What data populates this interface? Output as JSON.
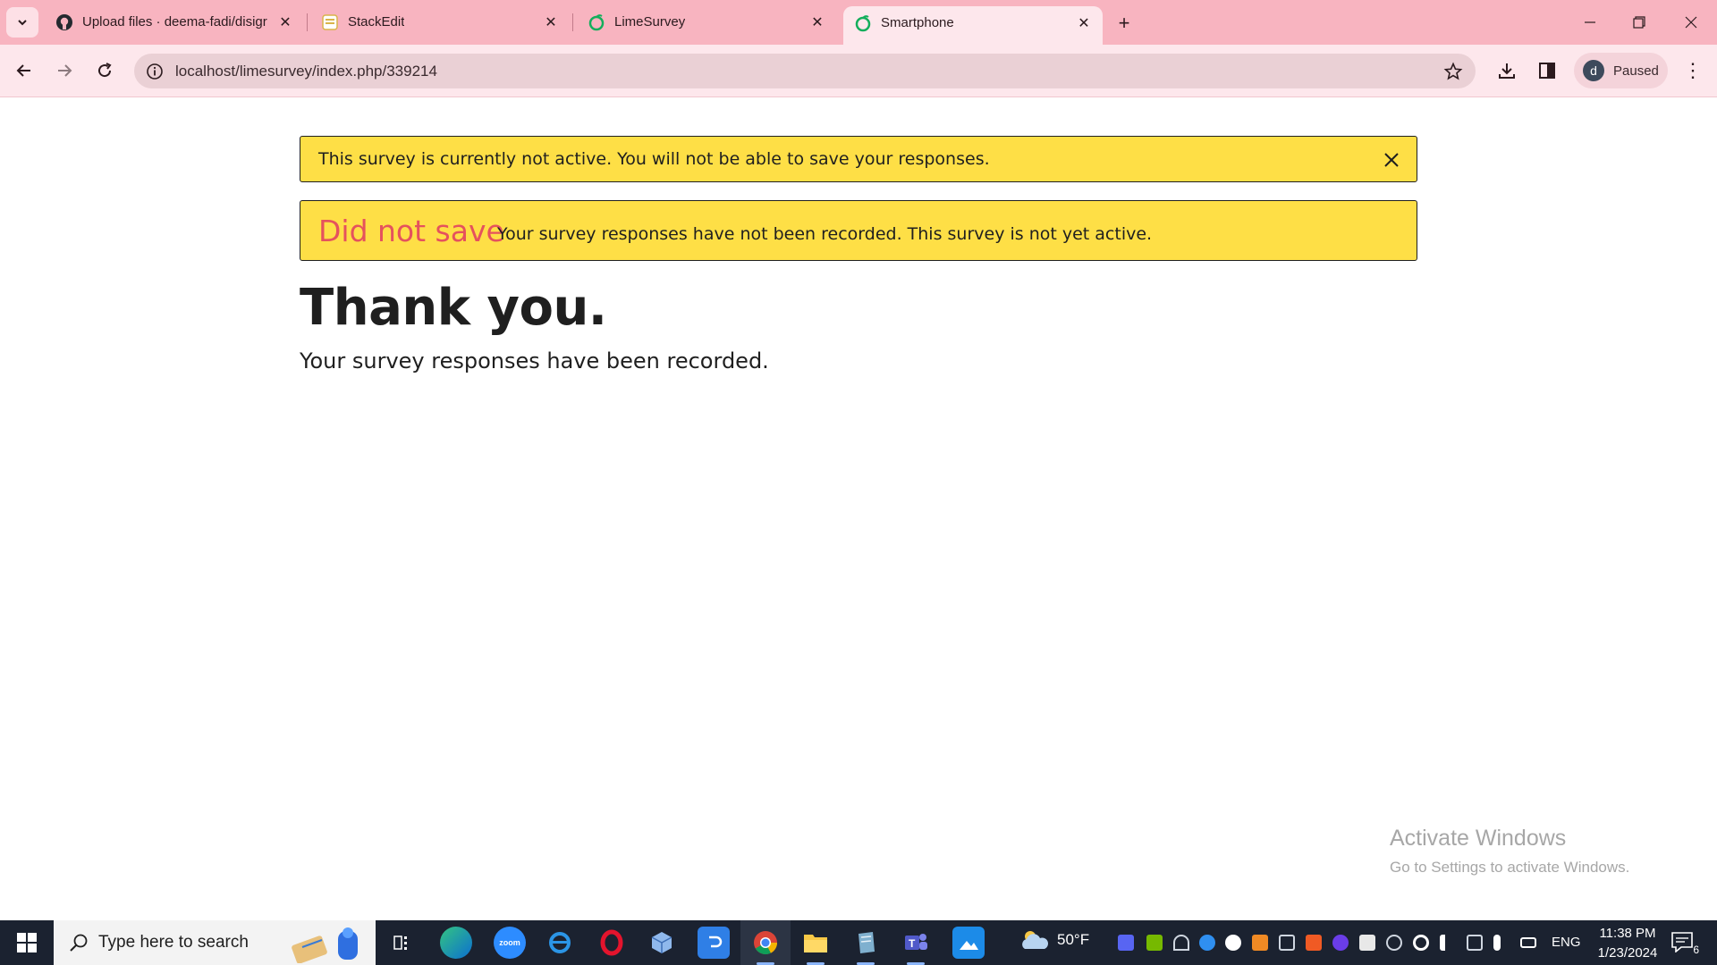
{
  "browser": {
    "tabs": [
      {
        "title": "Upload files · deema-fadi/disigr",
        "favicon": "github-icon",
        "active": false
      },
      {
        "title": "StackEdit",
        "favicon": "stackedit-icon",
        "active": false
      },
      {
        "title": "LimeSurvey",
        "favicon": "limesurvey-icon",
        "active": false
      },
      {
        "title": "Smartphone",
        "favicon": "limesurvey-icon",
        "active": true
      }
    ],
    "address": "localhost/limesurvey/index.php/339214",
    "profile_initial": "d",
    "profile_status": "Paused"
  },
  "page": {
    "alert_inactive": "This survey is currently not active. You will not be able to save your responses.",
    "alert_not_saved_strong": "Did not save",
    "alert_not_saved_text": "Your survey responses have not been recorded. This survey is not yet active.",
    "heading": "Thank you.",
    "subtext": "Your survey responses have been recorded."
  },
  "watermark": {
    "line1": "Activate Windows",
    "line2": "Go to Settings to activate Windows."
  },
  "taskbar": {
    "search_placeholder": "Type here to search",
    "weather_temp": "50°F",
    "language": "ENG",
    "time": "11:38 PM",
    "date": "1/23/2024",
    "notification_count": "6"
  },
  "colors": {
    "tabstrip": "#f8b4c0",
    "toolbar": "#fde7ec",
    "alert_bg": "#fedf46",
    "alert_strong": "#e5525d",
    "taskbar": "#1b2230"
  }
}
